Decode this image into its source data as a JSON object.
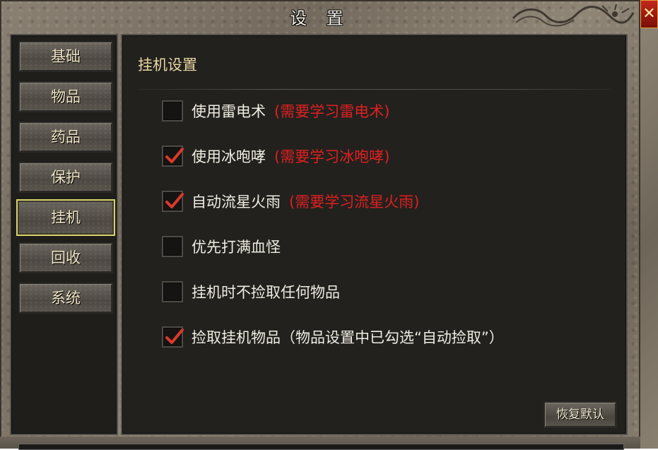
{
  "window": {
    "title": "设 置"
  },
  "sidebar": {
    "items": [
      {
        "label": "基础"
      },
      {
        "label": "物品"
      },
      {
        "label": "药品"
      },
      {
        "label": "保护"
      },
      {
        "label": "挂机",
        "active": true
      },
      {
        "label": "回收"
      },
      {
        "label": "系统"
      }
    ]
  },
  "main": {
    "section_title": "挂机设置",
    "options": [
      {
        "label": "使用雷电术",
        "note": "(需要学习雷电术)",
        "checked": false
      },
      {
        "label": "使用冰咆哮",
        "note": "(需要学习冰咆哮)",
        "checked": true
      },
      {
        "label": "自动流星火雨",
        "note": "(需要学习流星火雨)",
        "checked": true
      },
      {
        "label": "优先打满血怪",
        "note": "",
        "checked": false
      },
      {
        "label": "挂机时不捡取任何物品",
        "note": "",
        "checked": false
      },
      {
        "label": "捡取挂机物品（物品设置中已勾选“自动捡取”）",
        "note": "",
        "checked": true
      }
    ],
    "restore_label": "恢复默认"
  },
  "colors": {
    "accent": "#d8d26a",
    "note": "#e02020",
    "check": "#d93a2c"
  },
  "icons": {
    "close": "close-icon",
    "check": "checkmark-icon",
    "decoration": "dragon-ornament-icon"
  }
}
